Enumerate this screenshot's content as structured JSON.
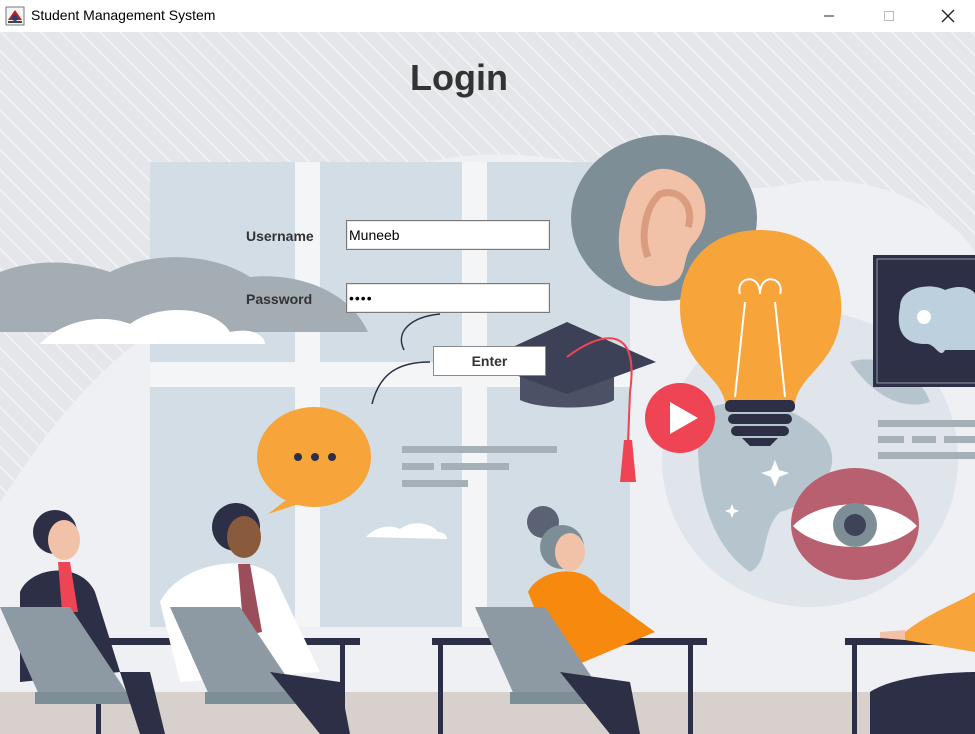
{
  "window": {
    "title": "Student Management System"
  },
  "login": {
    "heading": "Login",
    "username_label": "Username",
    "username_value": "Muneeb",
    "password_label": "Password",
    "password_value": "••••",
    "submit_label": "Enter"
  },
  "icons": {
    "app": "app-logo-icon",
    "minimize": "minimize-icon",
    "maximize": "maximize-icon",
    "close": "close-icon",
    "ear": "ear-icon",
    "lightbulb": "lightbulb-icon",
    "play": "play-icon",
    "eye": "eye-icon",
    "brain": "brain-icon",
    "graduation_cap": "graduation-cap-icon",
    "speech_bubble": "speech-bubble-icon"
  },
  "colors": {
    "background": "#e7e9ed",
    "text": "#333333",
    "orange": "#f7a43b",
    "slate": "#7e8e97",
    "navy": "#2c2f45",
    "red": "#ef4453"
  }
}
